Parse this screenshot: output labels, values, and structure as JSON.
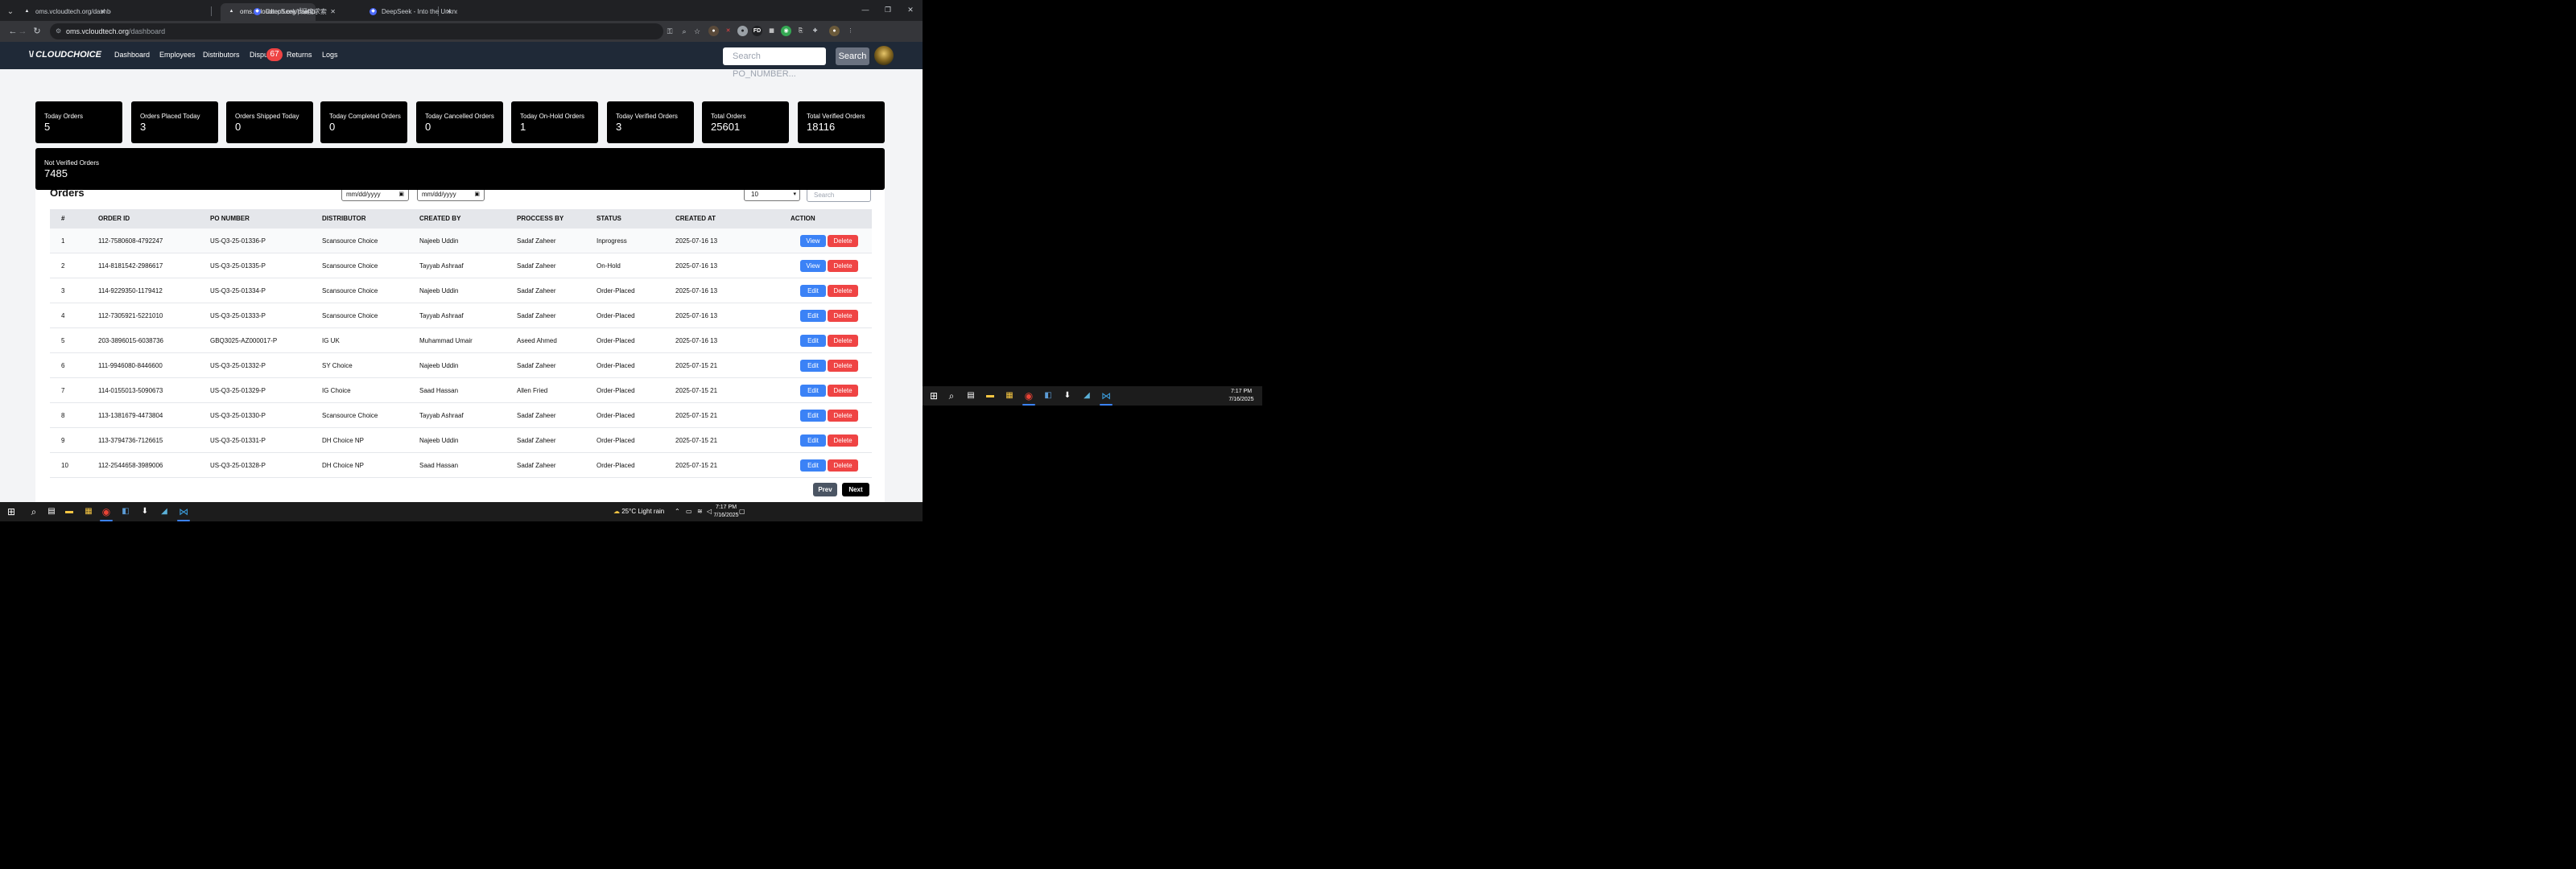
{
  "browser": {
    "tabs": [
      {
        "title": "oms.vcloudtech.org/dashboard",
        "active": false
      },
      {
        "title": "oms.vcloudtech.org/dashboard",
        "active": true
      },
      {
        "title": "DeepSeek | 深度求索",
        "active": false
      },
      {
        "title": "DeepSeek - Into the Unknown",
        "active": false
      }
    ],
    "url_host": "oms.vcloudtech.org",
    "url_path": "/dashboard"
  },
  "app": {
    "logo": "CLOUDCHOICE",
    "nav": [
      "Dashboard",
      "Employees",
      "Distributors",
      "Dispu",
      "Returns",
      "Logs"
    ],
    "disputes_badge": "67",
    "search_placeholder": "Search PO_NUMBER...",
    "search_button": "Search"
  },
  "stats": [
    {
      "label": "Today Orders",
      "value": "5"
    },
    {
      "label": "Orders Placed Today",
      "value": "3"
    },
    {
      "label": "Orders Shipped Today",
      "value": "0"
    },
    {
      "label": "Today Completed Orders",
      "value": "0"
    },
    {
      "label": "Today Cancelled Orders",
      "value": "0"
    },
    {
      "label": "Today On-Hold Orders",
      "value": "1"
    },
    {
      "label": "Today Verified Orders",
      "value": "3"
    },
    {
      "label": "Total Orders",
      "value": "25601"
    },
    {
      "label": "Total Verified Orders",
      "value": "18116"
    },
    {
      "label": "Not Verified Orders",
      "value": "7485"
    }
  ],
  "orders": {
    "title": "Orders",
    "date_from_placeholder": "mm/dd/yyyy",
    "date_to_placeholder": "mm/dd/yyyy",
    "page_size": "10",
    "search_placeholder": "Search",
    "columns": [
      "#",
      "ORDER ID",
      "PO NUMBER",
      "DISTRIBUTOR",
      "CREATED BY",
      "PROCCESS BY",
      "STATUS",
      "CREATED AT",
      "ACTION"
    ],
    "rows": [
      {
        "n": "1",
        "order_id": "112-7580608-4792247",
        "po": "US-Q3-25-01336-P",
        "distributor": "Scansource Choice",
        "created_by": "Najeeb Uddin",
        "process_by": "Sadaf Zaheer",
        "status": "Inprogress",
        "created_at": "2025-07-16 13",
        "primary": "View",
        "delete": "Delete"
      },
      {
        "n": "2",
        "order_id": "114-8181542-2986617",
        "po": "US-Q3-25-01335-P",
        "distributor": "Scansource Choice",
        "created_by": "Tayyab Ashraaf",
        "process_by": "Sadaf Zaheer",
        "status": "On-Hold",
        "created_at": "2025-07-16 13",
        "primary": "View",
        "delete": "Delete"
      },
      {
        "n": "3",
        "order_id": "114-9229350-1179412",
        "po": "US-Q3-25-01334-P",
        "distributor": "Scansource Choice",
        "created_by": "Najeeb Uddin",
        "process_by": "Sadaf Zaheer",
        "status": "Order-Placed",
        "created_at": "2025-07-16 13",
        "primary": "Edit",
        "delete": "Delete"
      },
      {
        "n": "4",
        "order_id": "112-7305921-5221010",
        "po": "US-Q3-25-01333-P",
        "distributor": "Scansource Choice",
        "created_by": "Tayyab Ashraaf",
        "process_by": "Sadaf Zaheer",
        "status": "Order-Placed",
        "created_at": "2025-07-16 13",
        "primary": "Edit",
        "delete": "Delete"
      },
      {
        "n": "5",
        "order_id": "203-3896015-6038736",
        "po": "GBQ3025-AZ000017-P",
        "distributor": "IG UK",
        "created_by": "Muhammad Umair",
        "process_by": "Aseed Ahmed",
        "status": "Order-Placed",
        "created_at": "2025-07-16 13",
        "primary": "Edit",
        "delete": "Delete"
      },
      {
        "n": "6",
        "order_id": "111-9946080-8446600",
        "po": "US-Q3-25-01332-P",
        "distributor": "SY Choice",
        "created_by": "Najeeb Uddin",
        "process_by": "Sadaf Zaheer",
        "status": "Order-Placed",
        "created_at": "2025-07-15 21",
        "primary": "Edit",
        "delete": "Delete"
      },
      {
        "n": "7",
        "order_id": "114-0155013-5090673",
        "po": "US-Q3-25-01329-P",
        "distributor": "IG Choice",
        "created_by": "Saad Hassan",
        "process_by": "Allen Fried",
        "status": "Order-Placed",
        "created_at": "2025-07-15 21",
        "primary": "Edit",
        "delete": "Delete"
      },
      {
        "n": "8",
        "order_id": "113-1381679-4473804",
        "po": "US-Q3-25-01330-P",
        "distributor": "Scansource Choice",
        "created_by": "Tayyab Ashraaf",
        "process_by": "Sadaf Zaheer",
        "status": "Order-Placed",
        "created_at": "2025-07-15 21",
        "primary": "Edit",
        "delete": "Delete"
      },
      {
        "n": "9",
        "order_id": "113-3794736-7126615",
        "po": "US-Q3-25-01331-P",
        "distributor": "DH Choice NP",
        "created_by": "Najeeb Uddin",
        "process_by": "Sadaf Zaheer",
        "status": "Order-Placed",
        "created_at": "2025-07-15 21",
        "primary": "Edit",
        "delete": "Delete"
      },
      {
        "n": "10",
        "order_id": "112-2544658-3989006",
        "po": "US-Q3-25-01328-P",
        "distributor": "DH Choice NP",
        "created_by": "Saad Hassan",
        "process_by": "Sadaf Zaheer",
        "status": "Order-Placed",
        "created_at": "2025-07-15 21",
        "primary": "Edit",
        "delete": "Delete"
      }
    ],
    "prev": "Prev",
    "next": "Next"
  },
  "taskbar": {
    "weather": "25°C  Light rain",
    "time": "7:17 PM",
    "date": "7/16/2025"
  },
  "taskbar2": {
    "time": "7:17 PM",
    "date": "7/16/2025"
  },
  "colors": {
    "header_bg": "#1f2937",
    "card_bg": "#000000",
    "view_button": "#3b82f6",
    "delete_button": "#ef4444"
  }
}
